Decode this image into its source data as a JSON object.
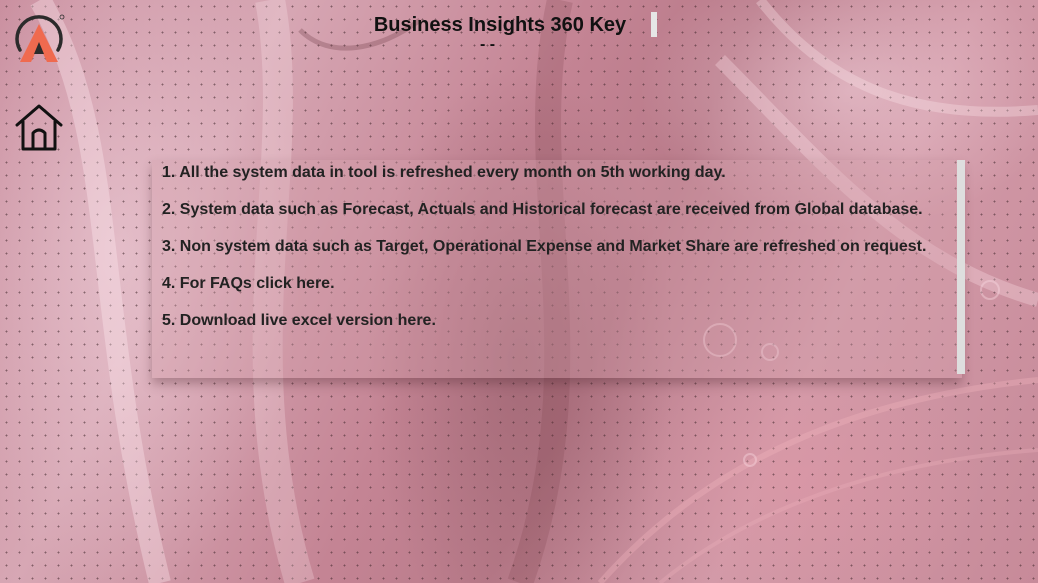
{
  "header": {
    "title": "Business Insights 360 Key",
    "subtitle_fragment": "- -"
  },
  "logo": {
    "icon": "atliq-logo-icon",
    "colors": {
      "outer": "#ef6a4f",
      "inner": "#2b2b2b"
    }
  },
  "nav": {
    "home_icon": "home-icon"
  },
  "notes": [
    {
      "text": "1. All the system data in tool is refreshed every month on 5th working day."
    },
    {
      "text": "2.  System data such as Forecast, Actuals and Historical forecast are received from Global database."
    },
    {
      "text": "3.  Non system data such as Target, Operational Expense and Market Share are refreshed on request."
    },
    {
      "text": "4. For FAQs click here."
    },
    {
      "text": "5. Download live excel version here."
    }
  ],
  "theme": {
    "background": "#c98e9e",
    "panel": "#d4a0ac",
    "text": "#222222"
  }
}
